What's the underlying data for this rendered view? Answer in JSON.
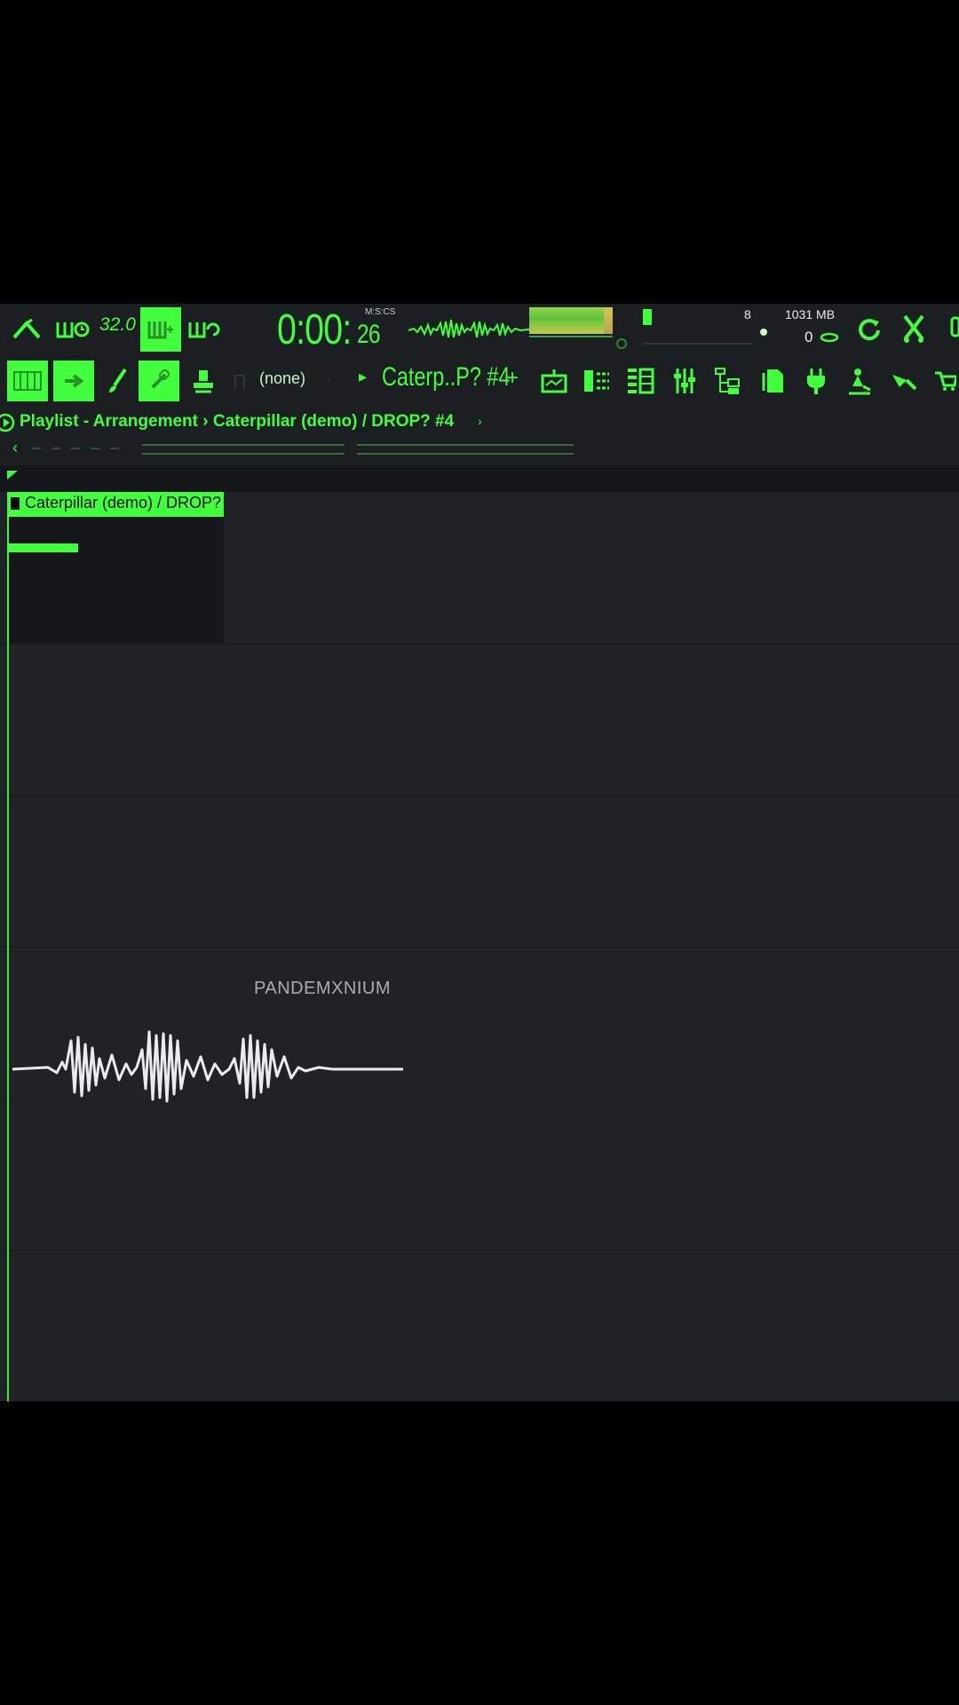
{
  "toolbar": {
    "tempo_display": "32.0",
    "time": {
      "main": "0:00:",
      "small": "26",
      "caption": "M:S:CS"
    },
    "status": {
      "cpu_count": "8",
      "memory": "1031 MB",
      "polyphony": "0"
    },
    "icons": [
      "metronome-icon",
      "wait-record-icon",
      "step-edit-icon",
      "typing-keyboard-icon",
      "blend-notes-icon",
      "loop-record-icon",
      "undo-icon",
      "cut-icon",
      "download-icon"
    ]
  },
  "toolbar2": {
    "pattern_none": "(none)",
    "pattern_name": "Caterp..P? #4",
    "plus": "+",
    "icons": [
      "piano-roll-icon",
      "arrow-icon",
      "brush-icon",
      "link-icon",
      "stamp-icon",
      "playlist-icon",
      "channel-rack-icon",
      "piano-roll-view-icon",
      "mixer-icon",
      "browser-icon",
      "project-icon",
      "plugin-icon",
      "touch-icon",
      "ai-icon",
      "cart-icon"
    ]
  },
  "playlist": {
    "title": "Playlist - Arrangement › Caterpillar (demo) / DROP? #4",
    "chevron": "›",
    "clip_name": "Caterpillar (demo) / DROP?"
  },
  "watermark": {
    "text": "PANDEMXNIUM"
  },
  "colors": {
    "accent": "#41ff3c",
    "background": "#1d2124",
    "toolbar": "#1b1f22"
  }
}
